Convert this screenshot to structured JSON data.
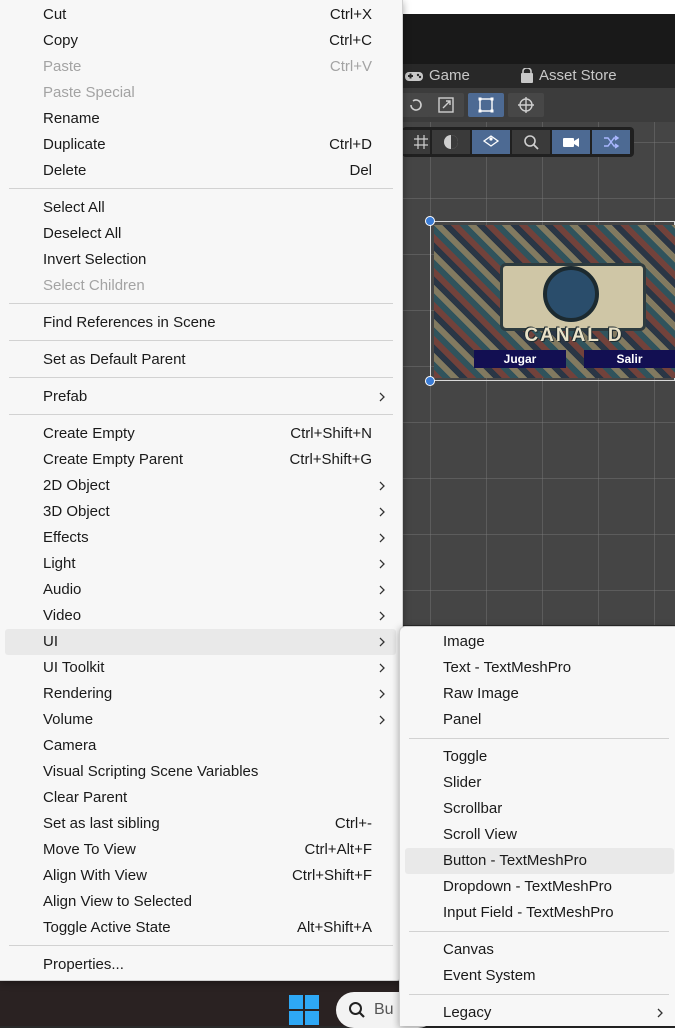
{
  "unity": {
    "tabs": {
      "game": "Game",
      "asset_store": "Asset Store"
    },
    "scene_image": {
      "title": "CANAL D",
      "button_play": "Jugar",
      "button_exit": "Salir"
    },
    "taskbar": {
      "search_placeholder": "Bu"
    }
  },
  "main_menu": {
    "items": [
      {
        "label": "Cut",
        "shortcut": "Ctrl+X"
      },
      {
        "label": "Copy",
        "shortcut": "Ctrl+C"
      },
      {
        "label": "Paste",
        "shortcut": "Ctrl+V",
        "disabled": true
      },
      {
        "label": "Paste Special",
        "disabled": true
      },
      {
        "label": "Rename"
      },
      {
        "label": "Duplicate",
        "shortcut": "Ctrl+D"
      },
      {
        "label": "Delete",
        "shortcut": "Del"
      },
      {
        "label": "Select All"
      },
      {
        "label": "Deselect All"
      },
      {
        "label": "Invert Selection"
      },
      {
        "label": "Select Children",
        "disabled": true
      },
      {
        "label": "Find References in Scene"
      },
      {
        "label": "Set as Default Parent"
      },
      {
        "label": "Prefab",
        "submenu": true
      },
      {
        "label": "Create Empty",
        "shortcut": "Ctrl+Shift+N"
      },
      {
        "label": "Create Empty Parent",
        "shortcut": "Ctrl+Shift+G"
      },
      {
        "label": "2D Object",
        "submenu": true
      },
      {
        "label": "3D Object",
        "submenu": true
      },
      {
        "label": "Effects",
        "submenu": true
      },
      {
        "label": "Light",
        "submenu": true
      },
      {
        "label": "Audio",
        "submenu": true
      },
      {
        "label": "Video",
        "submenu": true
      },
      {
        "label": "UI",
        "submenu": true,
        "highlighted": true
      },
      {
        "label": "UI Toolkit",
        "submenu": true
      },
      {
        "label": "Rendering",
        "submenu": true
      },
      {
        "label": "Volume",
        "submenu": true
      },
      {
        "label": "Camera"
      },
      {
        "label": "Visual Scripting Scene Variables"
      },
      {
        "label": "Clear Parent"
      },
      {
        "label": "Set as last sibling",
        "shortcut": "Ctrl+-"
      },
      {
        "label": "Move To View",
        "shortcut": "Ctrl+Alt+F"
      },
      {
        "label": "Align With View",
        "shortcut": "Ctrl+Shift+F"
      },
      {
        "label": "Align View to Selected"
      },
      {
        "label": "Toggle Active State",
        "shortcut": "Alt+Shift+A"
      },
      {
        "label": "Properties..."
      }
    ]
  },
  "ui_submenu": {
    "items": [
      {
        "label": "Image"
      },
      {
        "label": "Text - TextMeshPro"
      },
      {
        "label": "Raw Image"
      },
      {
        "label": "Panel"
      },
      {
        "label": "Toggle"
      },
      {
        "label": "Slider"
      },
      {
        "label": "Scrollbar"
      },
      {
        "label": "Scroll View"
      },
      {
        "label": "Button - TextMeshPro",
        "highlighted": true
      },
      {
        "label": "Dropdown - TextMeshPro"
      },
      {
        "label": "Input Field - TextMeshPro"
      },
      {
        "label": "Canvas"
      },
      {
        "label": "Event System"
      },
      {
        "label": "Legacy",
        "submenu": true
      }
    ]
  }
}
